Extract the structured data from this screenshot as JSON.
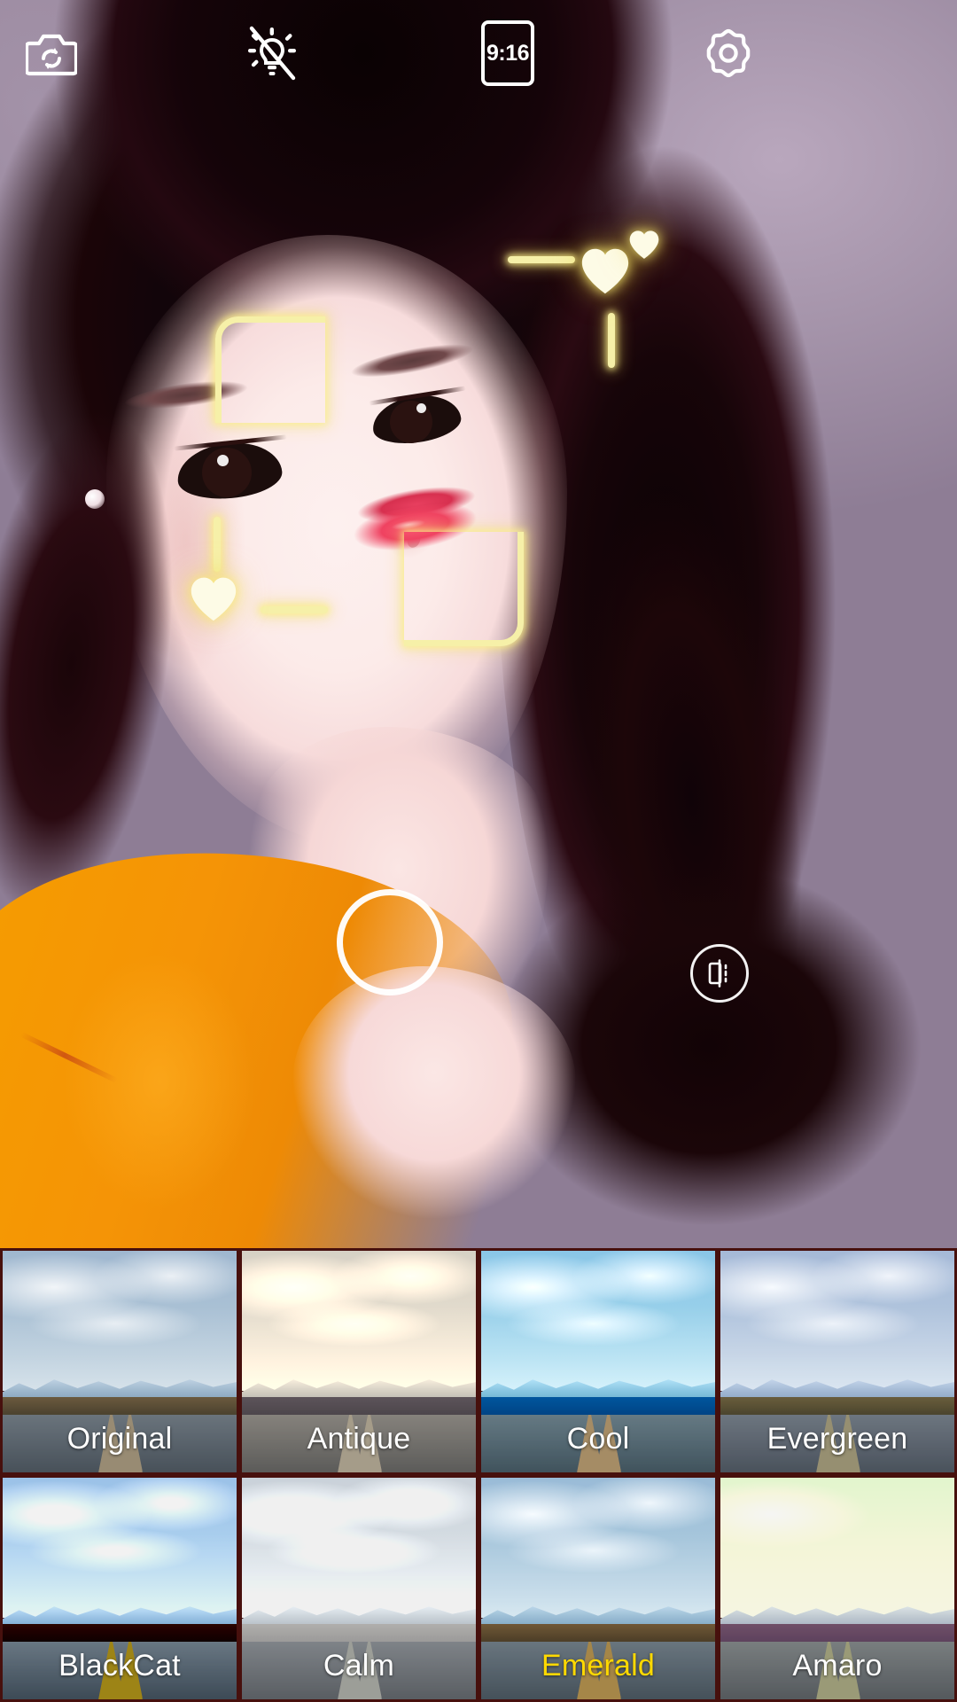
{
  "app": {
    "screen_name": "camera-filter-preview",
    "accent_selected": "#ffd900",
    "overlay_color": "#f6f0a8"
  },
  "topbar": {
    "flip_camera": {
      "icon": "camera-flip-icon",
      "label": "Switch camera"
    },
    "flash": {
      "icon": "flash-off-icon",
      "label": "Flash off",
      "state": "off"
    },
    "aspect_ratio": {
      "icon": "aspect-ratio-icon",
      "value": "9:16"
    },
    "settings": {
      "icon": "gear-icon",
      "label": "Settings"
    }
  },
  "viewfinder": {
    "face_detect": {
      "visible": true,
      "hearts": [
        "heart-icon",
        "heart-icon",
        "heart-icon"
      ]
    },
    "shutter": {
      "icon": "shutter-ring-icon",
      "label": "Capture"
    },
    "compare": {
      "icon": "split-compare-icon",
      "label": "Compare"
    }
  },
  "filters": {
    "selected": "Emerald",
    "items": [
      {
        "name": "Original",
        "fx": "fx-original",
        "selected": false
      },
      {
        "name": "Antique",
        "fx": "fx-antique",
        "selected": false
      },
      {
        "name": "Cool",
        "fx": "fx-cool",
        "selected": false
      },
      {
        "name": "Evergreen",
        "fx": "fx-evergreen",
        "selected": false
      },
      {
        "name": "BlackCat",
        "fx": "fx-blackcat",
        "selected": false
      },
      {
        "name": "Calm",
        "fx": "fx-calm",
        "selected": false
      },
      {
        "name": "Emerald",
        "fx": "fx-emerald",
        "selected": true
      },
      {
        "name": "Amaro",
        "fx": "fx-amaro",
        "selected": false
      }
    ]
  }
}
